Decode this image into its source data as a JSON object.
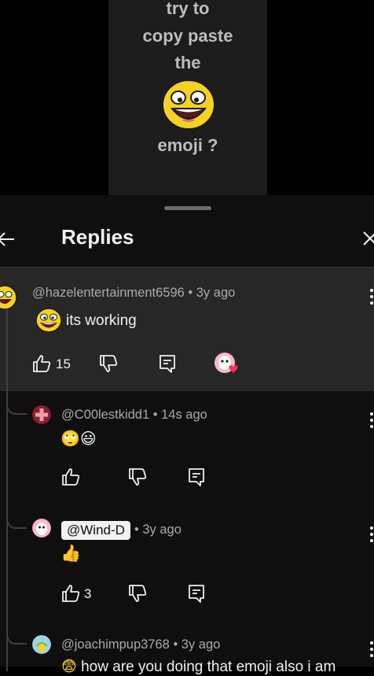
{
  "video": {
    "lines": [
      "try to",
      "copy paste",
      "the",
      "emoji ?"
    ]
  },
  "sheet": {
    "title": "Replies"
  },
  "parent_comment": {
    "author": "@hazelentertainment6596",
    "time": "• 3y ago",
    "text": "its working",
    "likes": "15"
  },
  "replies": [
    {
      "author": "@C00lestkidd1",
      "time": "• 14s ago",
      "text": "🙄😃",
      "likes": ""
    },
    {
      "author": "@Wind-D",
      "time": "• 3y ago",
      "text": "👍",
      "likes": "3"
    },
    {
      "author": "@joachimpup3768",
      "time": "• 3y ago",
      "text": "how are you doing that emoji also i am"
    }
  ],
  "colors": {
    "background": "#0f0f0f",
    "highlight": "#272727",
    "text": "#f1f1f1",
    "secondary_text": "#aaaaaa",
    "heart": "#ff2a55"
  }
}
